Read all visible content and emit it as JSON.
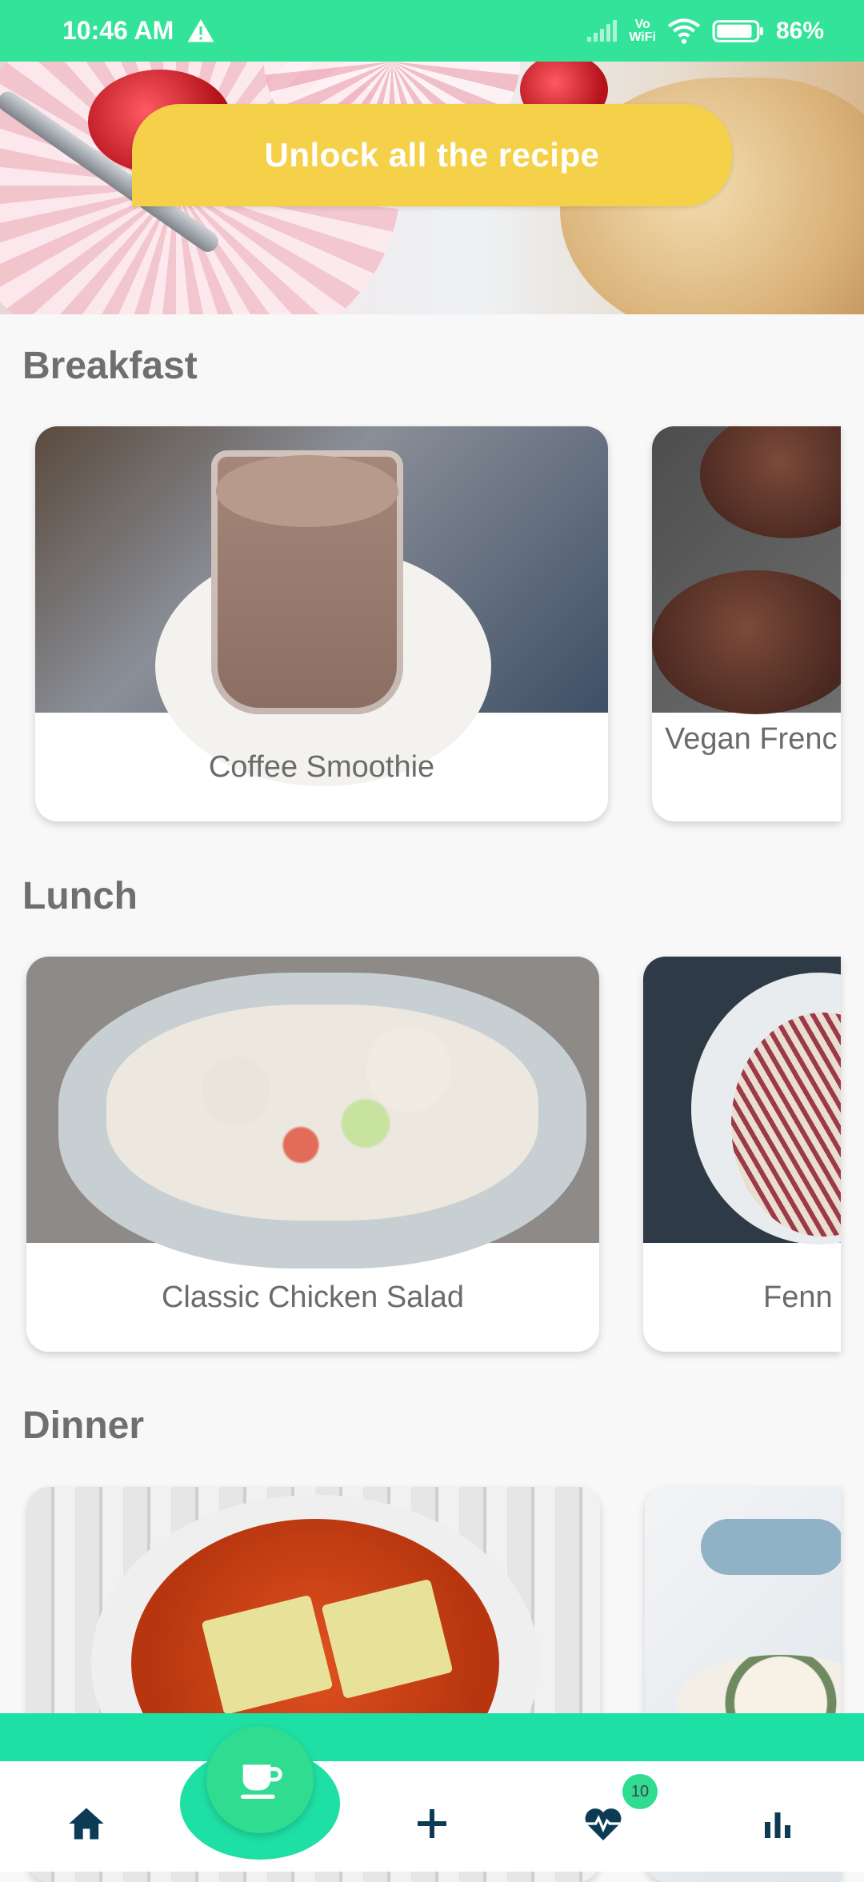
{
  "status_bar": {
    "time": "10:46 AM",
    "vowifi_top": "Vo",
    "vowifi_bottom": "WiFi",
    "battery": "86%"
  },
  "banner": {
    "cta_label": "Unlock all the recipe"
  },
  "sections": [
    {
      "title": "Breakfast",
      "cards": [
        {
          "label": "Coffee Smoothie"
        },
        {
          "label": "Vegan Frenc"
        }
      ]
    },
    {
      "title": "Lunch",
      "cards": [
        {
          "label": "Classic Chicken Salad"
        },
        {
          "label": "Fenn"
        }
      ]
    },
    {
      "title": "Dinner",
      "cards": [
        {
          "label": ""
        },
        {
          "label": ""
        }
      ]
    }
  ],
  "bottom_nav": {
    "items": [
      "home-icon",
      "coffee-cup-icon",
      "plus-icon",
      "heart-pulse-icon",
      "bar-chart-icon"
    ],
    "health_badge": "10"
  },
  "colors": {
    "accent": "#34e39a",
    "cta": "#f5d14a",
    "nav_band": "#1ee0a5"
  }
}
